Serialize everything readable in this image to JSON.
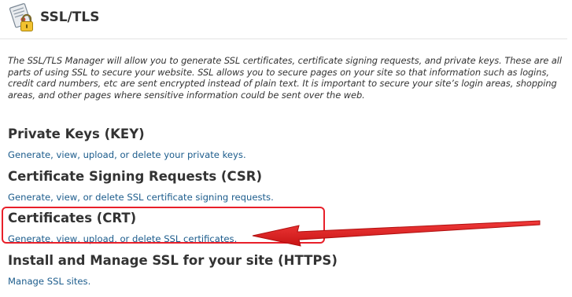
{
  "header": {
    "title": "SSL/TLS",
    "icon": "lock-certificate-icon"
  },
  "intro": {
    "text": "The SSL/TLS Manager will allow you to generate SSL certificates, certificate signing requests, and private keys. These are all parts of using SSL to secure your website. SSL allows you to secure pages on your site so that information such as logins, credit card numbers, etc are sent encrypted instead of plain text. It is important to secure your site’s login areas, shopping areas, and other pages where sensitive information could be sent over the web."
  },
  "sections": [
    {
      "title": "Private Keys (KEY)",
      "link": "Generate, view, upload, or delete your private keys."
    },
    {
      "title": "Certificate Signing Requests (CSR)",
      "link": "Generate, view, or delete SSL certificate signing requests."
    },
    {
      "title": "Certificates (CRT)",
      "link": "Generate, view, upload, or delete SSL certificates."
    },
    {
      "title": "Install and Manage SSL for your site (HTTPS)",
      "link": "Manage SSL sites."
    }
  ],
  "annotation": {
    "highlight_color": "#e8202a",
    "arrow_color": "#e8202a"
  },
  "colors": {
    "link": "#1c5c8c",
    "text": "#333333"
  }
}
